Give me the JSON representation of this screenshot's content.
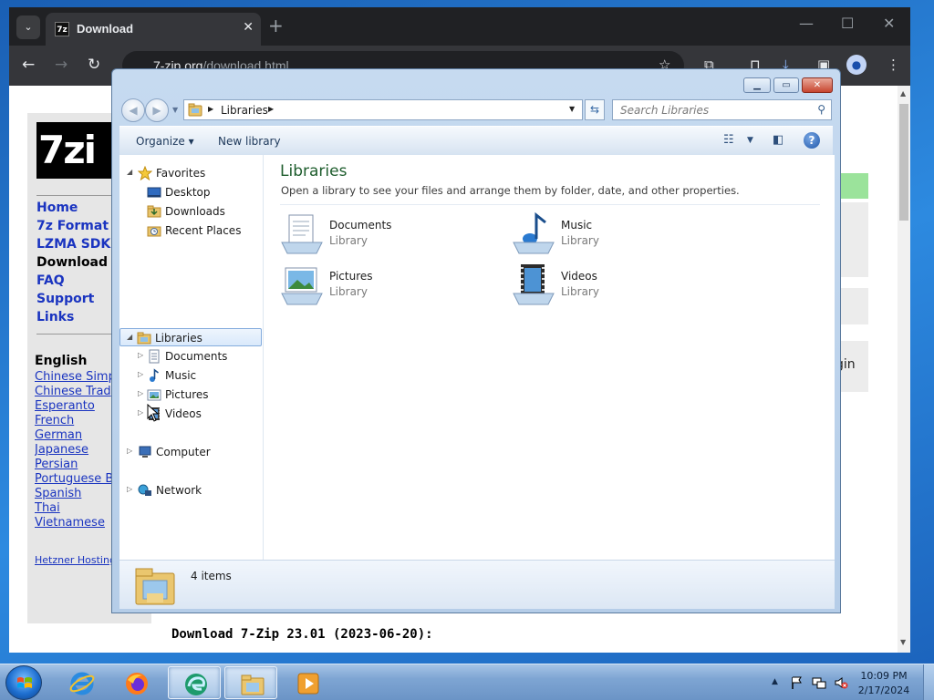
{
  "browser": {
    "tab_title": "Download",
    "url_host": "7-zip.org",
    "url_path": "/download.html"
  },
  "site": {
    "logo_text": "7zi",
    "nav": [
      "Home",
      "7z Format",
      "LZMA SDK",
      "Download",
      "FAQ",
      "Support",
      "Links"
    ],
    "active_nav": "Download",
    "languages_heading": "English",
    "languages": [
      "Chinese Simp",
      "Chinese Trad",
      "Esperanto",
      "French",
      "German",
      "Japanese",
      "Persian",
      "Portuguese B",
      "Spanish",
      "Thai",
      "Vietnamese"
    ],
    "hosting": "Hetzner Hosting",
    "login_fragment": "gin",
    "download_heading": "Download 7-Zip 23.01 (2023-06-20):"
  },
  "explorer": {
    "address": "Libraries",
    "search_placeholder": "Search Libraries",
    "commands": {
      "organize": "Organize",
      "new_library": "New library"
    },
    "nav_pane": {
      "favorites": "Favorites",
      "favorites_items": [
        "Desktop",
        "Downloads",
        "Recent Places"
      ],
      "libraries": "Libraries",
      "libraries_items": [
        "Documents",
        "Music",
        "Pictures",
        "Videos"
      ],
      "computer": "Computer",
      "network": "Network"
    },
    "content": {
      "title": "Libraries",
      "subtitle": "Open a library to see your files and arrange them by folder, date, and other properties.",
      "tiles": [
        {
          "name": "Documents",
          "type": "Library",
          "icon": "documents-icon"
        },
        {
          "name": "Music",
          "type": "Library",
          "icon": "music-icon"
        },
        {
          "name": "Pictures",
          "type": "Library",
          "icon": "pictures-icon"
        },
        {
          "name": "Videos",
          "type": "Library",
          "icon": "videos-icon"
        }
      ]
    },
    "status": "4 items"
  },
  "taskbar": {
    "apps": [
      "internet-explorer-icon",
      "firefox-icon",
      "edge-icon",
      "explorer-icon",
      "media-player-icon"
    ],
    "time": "10:09 PM",
    "date": "2/17/2024"
  }
}
